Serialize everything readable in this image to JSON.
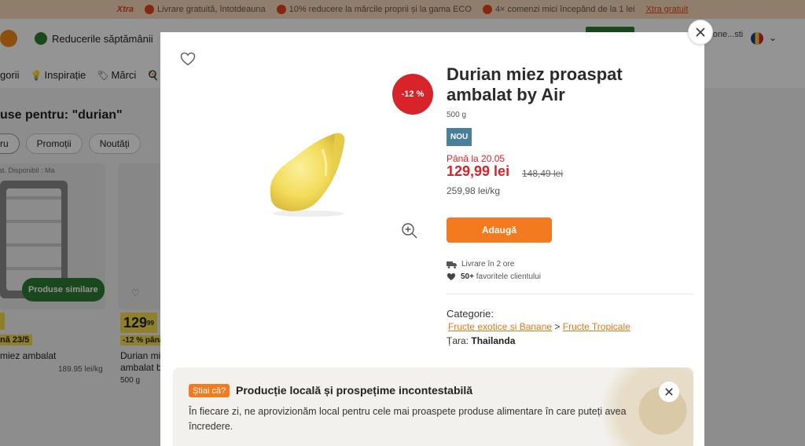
{
  "promo_bar": {
    "brand": "Xtra",
    "items": [
      "Livrare gratuită, întotdeauna",
      "10% reducere la mărcile proprii și la gama ECO",
      "4× comenzi mici începând de la 1 lei"
    ],
    "link": "Xtra gratuit"
  },
  "header": {
    "weekly_label": "Reducerile săptămânii",
    "account_fragment": "Zone...sti"
  },
  "nav": {
    "items": [
      "gorii",
      "Inspirație",
      "Mărci",
      "Re"
    ]
  },
  "search_results": {
    "title": "use pentru: \"durian\"",
    "chips": [
      "ru",
      "Promoții",
      "Noutăți"
    ]
  },
  "card1": {
    "availability": "at. Disponibil : Ma",
    "similar_label": "Produse similare",
    "until": "nă 23/5",
    "name": "miez ambalat",
    "unit_price": "189.95 lei/kg"
  },
  "card2": {
    "price_main": "129",
    "price_cents": "99",
    "discount": "-12 % până",
    "name_line1": "Durian mi",
    "name_line2": "ambalat b",
    "weight": "500 g"
  },
  "product": {
    "discount_badge": "-12 %",
    "title": "Durian miez proaspat ambalat by Air",
    "weight": "500 g",
    "new_badge": "NOU",
    "until": "Până la 20.05",
    "price_now": "129,99 lei",
    "price_old": "148,49 lei",
    "price_per_kg": "259,98 lei/kg",
    "add_button": "Adaugă",
    "delivery": "Livrare în 2 ore",
    "favorites_count": "50+",
    "favorites_text": "favoritele clientului",
    "category_label": "Categorie:",
    "category_1": "Fructe exotice si Banane",
    "category_sep": ">",
    "category_2": "Fructe Tropicale",
    "country_label": "Țara:",
    "country": "Thailanda"
  },
  "info_box": {
    "tag": "Știai că?",
    "title": "Producție locală și prospețime incontestabilă",
    "text": "În fiecare zi, ne aprovizionăm local pentru cele mai proaspete produse alimentare în care puteți avea încredere."
  },
  "colors": {
    "accent_orange": "#f47a1f",
    "sale_red": "#d9232b",
    "brand_green": "#2e7d32",
    "new_badge_blue": "#4a7f9c",
    "promo_yellow": "#f7dd4a"
  },
  "icons": [
    "heart-icon",
    "zoom-in-icon",
    "close-icon",
    "truck-icon",
    "heart-filled-icon"
  ]
}
